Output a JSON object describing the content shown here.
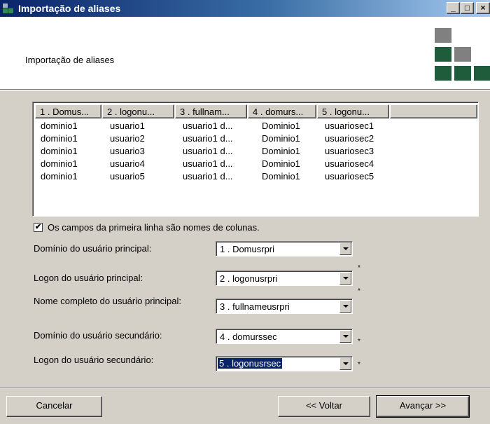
{
  "window": {
    "title": "Importação de aliases",
    "controls": {
      "minimize": "_",
      "maximize": "□",
      "close": "×"
    }
  },
  "header": {
    "text": "Importação de aliases",
    "logo_icon": "squares-logo-icon",
    "logo_colors": [
      "#808080",
      "#1e5c3c"
    ]
  },
  "table": {
    "columns": [
      "1 . Domus...",
      "2 . logonu...",
      "3 . fullnam...",
      "4 . domurs...",
      "5 . logonu..."
    ],
    "rows": [
      [
        "dominio1",
        "usuario1",
        "usuario1 d...",
        "Dominio1",
        "usuariosec1"
      ],
      [
        "dominio1",
        "usuario2",
        "usuario1 d...",
        "Dominio1",
        "usuariosec2"
      ],
      [
        "dominio1",
        "usuario3",
        "usuario1 d...",
        "Dominio1",
        "usuariosec3"
      ],
      [
        "dominio1",
        "usuario4",
        "usuario1 d...",
        "Dominio1",
        "usuariosec4"
      ],
      [
        "dominio1",
        "usuario5",
        "usuario1 d...",
        "Dominio1",
        "usuariosec5"
      ]
    ]
  },
  "first_row_checkbox": {
    "checked": true,
    "mark": "✔",
    "label": "Os campos da primeira linha são nomes de colunas."
  },
  "form": {
    "primary_domain": {
      "label": "Domínio do usuário principal:",
      "value": "1 . Domusrpri",
      "required": ""
    },
    "primary_logon": {
      "label": "Logon do usuário principal:",
      "value": "2 . logonusrpri",
      "required": "*"
    },
    "primary_fullname": {
      "label": "Nome completo do usuário principal:",
      "value": "3 . fullnameusrpri",
      "required": "*"
    },
    "secondary_domain": {
      "label": "Domínio do usuário secundário:",
      "value": "4 . domurssec",
      "required": "*"
    },
    "secondary_logon": {
      "label": "Logon do usuário secundário:",
      "value": "5 . logonusrsec",
      "required": "*"
    }
  },
  "buttons": {
    "cancel": "Cancelar",
    "back": "<< Voltar",
    "next": "Avançar >>"
  }
}
